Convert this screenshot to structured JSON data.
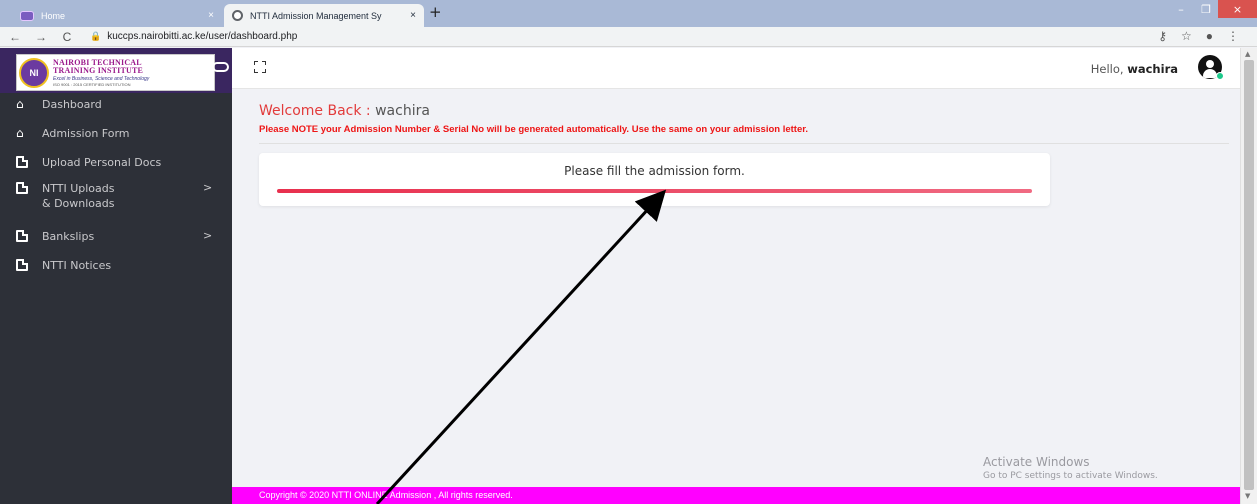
{
  "browser": {
    "tabs": [
      {
        "label": "Home",
        "close": "×"
      },
      {
        "label": "NTTI Admission Management Sy",
        "close": "×"
      }
    ],
    "new_tab": "+",
    "window_controls": {
      "minimize": "–",
      "maximize": "❐",
      "close": "×"
    },
    "nav": {
      "back": "←",
      "forward": "→",
      "reload": "C"
    },
    "lock": "🔒",
    "url": "kuccps.nairobitti.ac.ke/user/dashboard.php",
    "toolbar_icons": {
      "key": "⚷",
      "star": "☆",
      "profile": "●",
      "menu": "⋮"
    }
  },
  "logo": {
    "seal_text": "NI",
    "line1": "NAIROBI TECHNICAL",
    "line2": "TRAINING INSTITUTE",
    "tagline": "Excel in Business, Science and Technology",
    "iso": "ISO 9001 : 2015 CERTIFIED INSTITUTION"
  },
  "sidebar": {
    "items": [
      {
        "icon": "home-icon",
        "label": "Dashboard"
      },
      {
        "icon": "home-icon",
        "label": "Admission Form"
      },
      {
        "icon": "document-icon",
        "label": "Upload Personal Docs"
      },
      {
        "icon": "document-icon",
        "label": "NTTI Uploads",
        "label2": "& Downloads",
        "arrow": ">"
      },
      {
        "icon": "document-icon",
        "label": "Bankslips",
        "arrow": ">"
      },
      {
        "icon": "document-icon",
        "label": "NTTI Notices"
      }
    ]
  },
  "header": {
    "greeting": "Hello,",
    "username": "wachira"
  },
  "main": {
    "welcome_prefix": "Welcome Back : ",
    "welcome_user": "wachira",
    "notice": "Please NOTE your Admission Number & Serial No will be generated automatically. Use the same on your admission letter.",
    "card_title": "Please fill the admission form.",
    "progress_fraction": 1.0
  },
  "watermark": {
    "line1": "Activate Windows",
    "line2": "Go to PC settings to activate Windows."
  },
  "footer": {
    "text": "Copyright © 2020 NTTI ONLINE Admission , All rights reserved."
  },
  "colors": {
    "sidebar_bg": "#2d3038",
    "brand_bg": "#3a2660",
    "accent_red": "#e23b3b",
    "footer_bg": "#ff00ff",
    "progress": "#e8304e"
  }
}
